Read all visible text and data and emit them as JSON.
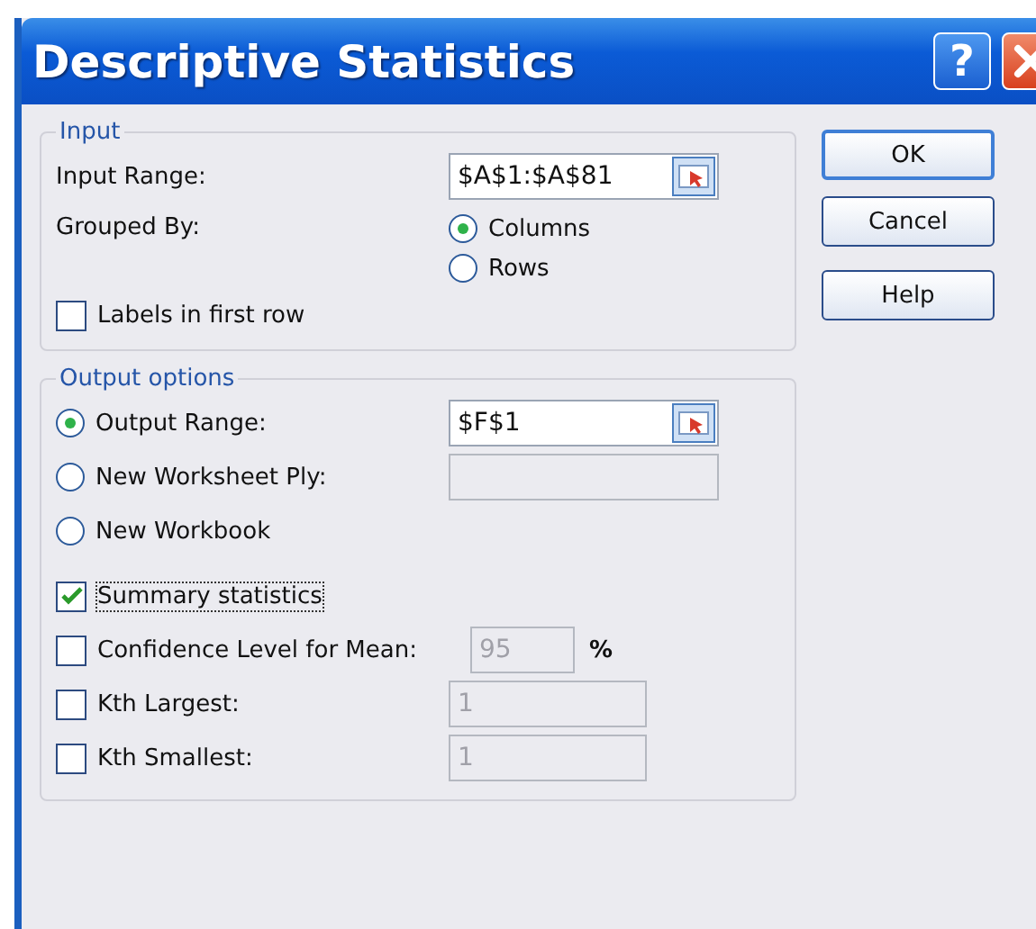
{
  "window": {
    "title": "Descriptive Statistics",
    "help_glyph": "?"
  },
  "input": {
    "legend": "Input",
    "range": {
      "label": "Input Range:",
      "value": "$A$1:$A$81"
    },
    "grouped_by": {
      "label": "Grouped By:",
      "options": [
        {
          "label": "Columns",
          "selected": true
        },
        {
          "label": "Rows",
          "selected": false
        }
      ]
    },
    "labels_in_first_row": {
      "label": "Labels in first row",
      "checked": false
    }
  },
  "buttons": [
    {
      "label": "OK",
      "default": true
    },
    {
      "label": "Cancel",
      "default": false
    },
    {
      "label": "Help",
      "default": false
    }
  ],
  "output": {
    "legend": "Output options",
    "items": [
      {
        "kind": "radio",
        "label": "Output Range:",
        "selected": true,
        "field": {
          "value": "$F$1",
          "disabled": false
        }
      },
      {
        "kind": "radio",
        "label": "New Worksheet Ply:",
        "selected": false,
        "field": {
          "disabled": true
        }
      },
      {
        "kind": "radio",
        "label": "New Workbook",
        "selected": false
      },
      {
        "kind": "checkbox",
        "label": "Summary statistics",
        "checked": true,
        "focused": true
      },
      {
        "kind": "checkbox",
        "label": "Confidence Level for Mean:",
        "checked": false,
        "focused": false,
        "field": {
          "value": "95",
          "disabled": true
        },
        "suffix": "%"
      },
      {
        "kind": "checkbox",
        "label": "Kth Largest:",
        "checked": false,
        "focused": false,
        "field": {
          "value": "1",
          "disabled": true
        }
      },
      {
        "kind": "checkbox",
        "label": "Kth Smallest:",
        "checked": false,
        "focused": false,
        "field": {
          "value": "1",
          "disabled": true
        }
      }
    ]
  }
}
